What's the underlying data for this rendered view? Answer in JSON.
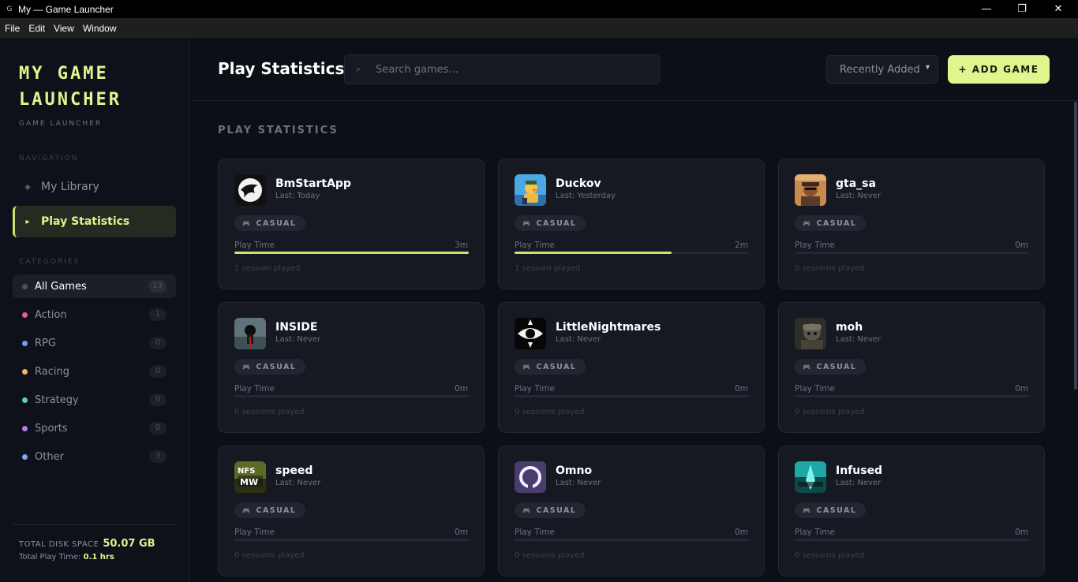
{
  "window": {
    "title": "My — Game Launcher",
    "app_icon": "G",
    "controls": [
      "minimize",
      "restore",
      "close"
    ]
  },
  "menu": [
    "File",
    "Edit",
    "View",
    "Window"
  ],
  "sidebar": {
    "brand_title": "MY GAME LAUNCHER",
    "brand_subtitle": "GAME LAUNCHER",
    "nav_label": "NAVIGATION",
    "nav": [
      {
        "label": "My Library",
        "icon": "library-icon"
      },
      {
        "label": "Play Statistics",
        "icon": "play-icon",
        "active": true
      }
    ],
    "categories_label": "CATEGORIES",
    "categories": [
      {
        "label": "All Games",
        "count": "13",
        "color": "#4b5060",
        "active": true
      },
      {
        "label": "Action",
        "count": "1",
        "color": "#ef5b8f"
      },
      {
        "label": "RPG",
        "count": "0",
        "color": "#6aa0ef"
      },
      {
        "label": "Racing",
        "count": "0",
        "color": "#f6b06a"
      },
      {
        "label": "Strategy",
        "count": "0",
        "color": "#5fd6a5"
      },
      {
        "label": "Sports",
        "count": "0",
        "color": "#b57cf2"
      },
      {
        "label": "Other",
        "count": "3",
        "color": "#7da6ef"
      }
    ],
    "disk_label": "TOTAL DISK SPACE",
    "disk_value": "50.07 GB",
    "playtime_label": "Total Play Time:",
    "playtime_value": "0.1 hrs"
  },
  "header": {
    "title": "Play Statistics",
    "search_placeholder": "Search games...",
    "sort_value": "Recently Added",
    "add_button": "+ ADD GAME"
  },
  "section_title": "PLAY STATISTICS",
  "colors": {
    "accent": "#dff58d",
    "bar": "#c6e86a"
  },
  "games": [
    {
      "name": "BmStartApp",
      "last": "Last: Today",
      "tag": "CASUAL",
      "play_time_label": "Play Time",
      "play_time": "3m",
      "progress": 1.0,
      "sessions": "1 session played",
      "thumb": "bm"
    },
    {
      "name": "Duckov",
      "last": "Last: Yesterday",
      "tag": "CASUAL",
      "play_time_label": "Play Time",
      "play_time": "2m",
      "progress": 0.67,
      "sessions": "1 session played",
      "thumb": "duck"
    },
    {
      "name": "gta_sa",
      "last": "Last: Never",
      "tag": "CASUAL",
      "play_time_label": "Play Time",
      "play_time": "0m",
      "progress": 0,
      "sessions": "0 sessions played",
      "thumb": "gta"
    },
    {
      "name": "INSIDE",
      "last": "Last: Never",
      "tag": "CASUAL",
      "play_time_label": "Play Time",
      "play_time": "0m",
      "progress": 0,
      "sessions": "0 sessions played",
      "thumb": "inside"
    },
    {
      "name": "LittleNightmares",
      "last": "Last: Never",
      "tag": "CASUAL",
      "play_time_label": "Play Time",
      "play_time": "0m",
      "progress": 0,
      "sessions": "0 sessions played",
      "thumb": "eye"
    },
    {
      "name": "moh",
      "last": "Last: Never",
      "tag": "CASUAL",
      "play_time_label": "Play Time",
      "play_time": "0m",
      "progress": 0,
      "sessions": "0 sessions played",
      "thumb": "moh"
    },
    {
      "name": "speed",
      "last": "Last: Never",
      "tag": "CASUAL",
      "play_time_label": "Play Time",
      "play_time": "0m",
      "progress": 0,
      "sessions": "0 sessions played",
      "thumb": "nfs"
    },
    {
      "name": "Omno",
      "last": "Last: Never",
      "tag": "CASUAL",
      "play_time_label": "Play Time",
      "play_time": "0m",
      "progress": 0,
      "sessions": "0 sessions played",
      "thumb": "omno"
    },
    {
      "name": "Infused",
      "last": "Last: Never",
      "tag": "CASUAL",
      "play_time_label": "Play Time",
      "play_time": "0m",
      "progress": 0,
      "sessions": "0 sessions played",
      "thumb": "infused"
    }
  ]
}
